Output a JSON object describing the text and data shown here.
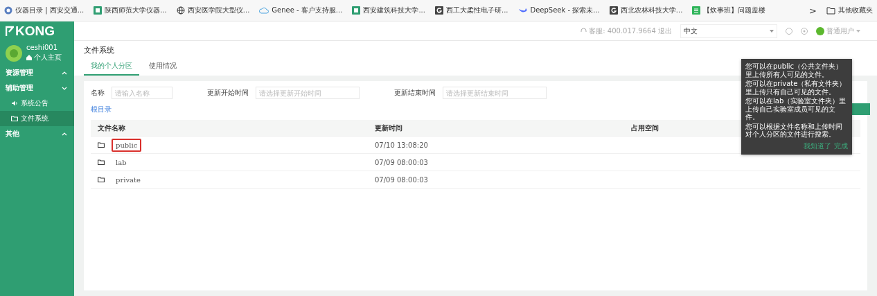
{
  "bookmarks": [
    {
      "label": "仪器目录 | 西安交通...",
      "kind": "seal"
    },
    {
      "label": "陕西师范大学仪器...",
      "kind": "square"
    },
    {
      "label": "西安医学院大型仪...",
      "kind": "globe"
    },
    {
      "label": "Genee - 客户支持服...",
      "kind": "cloud"
    },
    {
      "label": "西安建筑科技大学...",
      "kind": "square"
    },
    {
      "label": "西工大柔性电子研...",
      "kind": "g"
    },
    {
      "label": "DeepSeek - 探索未...",
      "kind": "whale"
    },
    {
      "label": "西北农林科技大学...",
      "kind": "g"
    },
    {
      "label": "【炊事班】问题盖楼",
      "kind": "sheet"
    }
  ],
  "bookmarks_more": ">",
  "other_bookmarks": "其他收藏夹",
  "logo": "KONG",
  "header": {
    "service": "客服: 400.017.9664 退出",
    "language": "中文",
    "user": "普通用户"
  },
  "user": {
    "name": "ceshi001",
    "home": "个人主页"
  },
  "sidebar": [
    {
      "label": "资源管理",
      "expanded": false
    },
    {
      "label": "辅助管理",
      "expanded": true,
      "children": [
        {
          "label": "系统公告",
          "kind": "speaker",
          "selected": false
        },
        {
          "label": "文件系统",
          "kind": "folder",
          "selected": true
        }
      ]
    },
    {
      "label": "其他",
      "expanded": false
    }
  ],
  "page_title": "文件系统",
  "tabs": [
    {
      "label": "我的个人分区",
      "selected": true
    },
    {
      "label": "使用情况",
      "selected": false
    }
  ],
  "filters": [
    {
      "label": "名称",
      "placeholder": "请输入名称"
    },
    {
      "label": "更新开始时间",
      "placeholder": "请选择更新开始时间"
    },
    {
      "label": "更新结束时间",
      "placeholder": "请选择更新结束时间"
    }
  ],
  "breadcrumb": "根目录",
  "table": {
    "columns": [
      "文件名称",
      "更新时间",
      "占用空间"
    ],
    "rows": [
      {
        "name": "public",
        "updated": "07/10 13:08:20",
        "highlighted": true
      },
      {
        "name": "lab",
        "updated": "07/09 08:00:03",
        "highlighted": false
      },
      {
        "name": "private",
        "updated": "07/09 08:00:03",
        "highlighted": false
      }
    ]
  },
  "tooltip": {
    "lines": [
      "您可以在public（公共文件夹）里上传所有人可见的文件。",
      "您可以在private（私有文件夹）里上传只有自己可见的文件。",
      "您可以在lab（实验室文件夹）里上传自己实验室成员可见的文件。",
      "您可以根据文件名称和上传时间对个人分区的文件进行搜索。"
    ],
    "dismiss": "我知道了",
    "done": "完成"
  }
}
